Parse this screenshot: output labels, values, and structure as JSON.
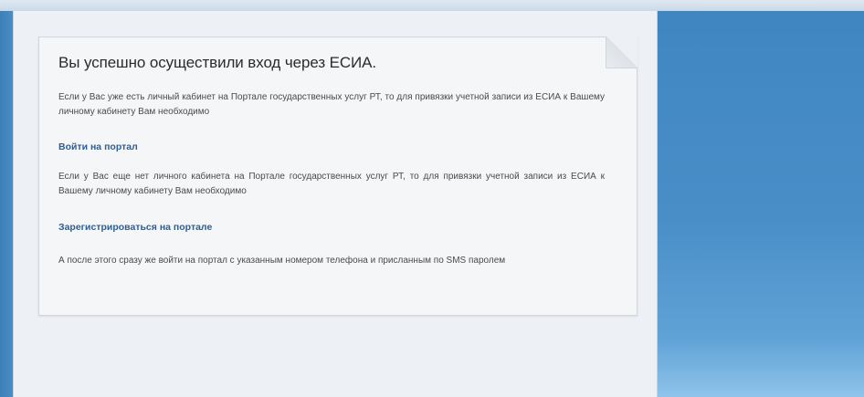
{
  "card": {
    "title": "Вы успешно осуществили вход через ЕСИА.",
    "paragraph_existing": "Если у Вас уже есть личный кабинет на Портале государственных услуг РТ, то для привязки учетной записи из ЕСИА к Вашему личному кабинету Вам необходимо",
    "login_link": "Войти на портал",
    "paragraph_new": "Если у Вас еще нет личного кабинета на Портале государственных услуг РТ, то для привязки учетной записи из ЕСИА к Вашему личному кабинету Вам необходимо",
    "register_link": "Зарегистрироваться на портале",
    "paragraph_after": "А после этого сразу же войти на портал с указанным номером телефона и присланным по SMS паролем"
  }
}
